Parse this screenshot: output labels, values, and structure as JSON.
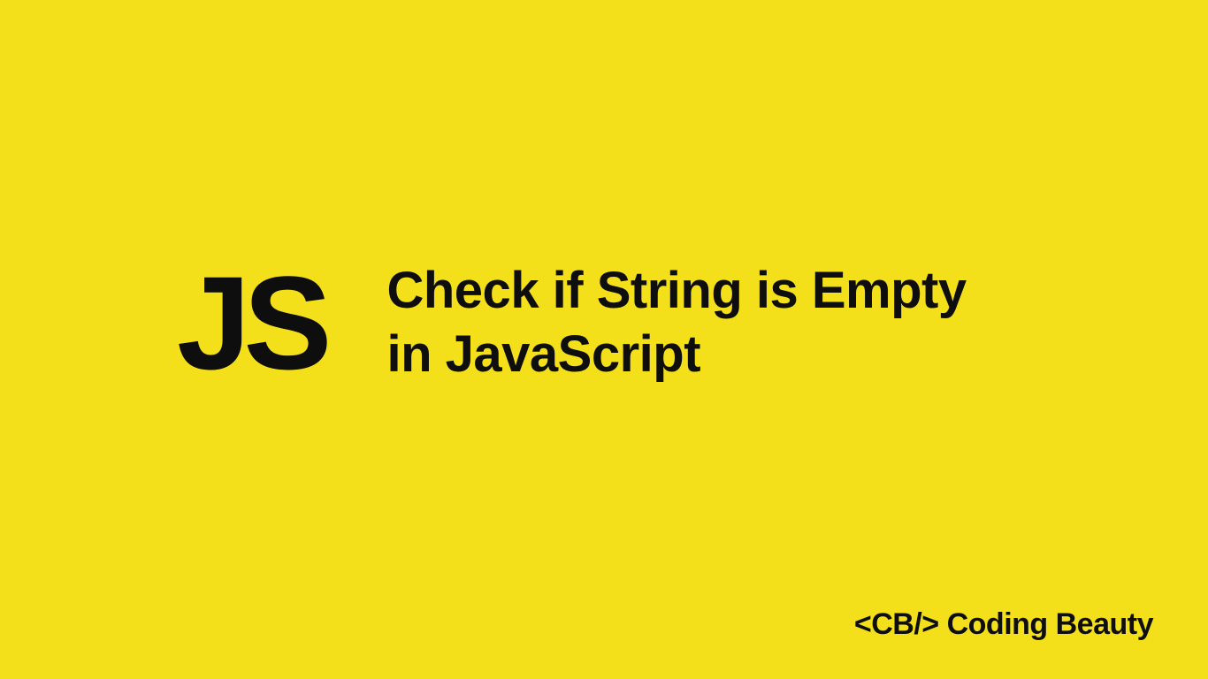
{
  "colors": {
    "background": "#f3df1a",
    "text": "#0e0e0e"
  },
  "logo": {
    "text": "JS"
  },
  "title": {
    "line1": "Check if String is Empty",
    "line2": "in JavaScript"
  },
  "footer": {
    "text": "<CB/> Coding Beauty"
  }
}
